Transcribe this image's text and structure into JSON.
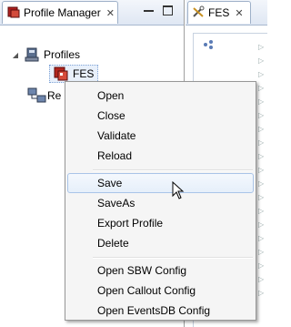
{
  "left_view": {
    "tab_title": "Profile Manager",
    "close_glyph": "✕",
    "tree": {
      "profiles_label": "Profiles",
      "fes_label": "FES",
      "second_root_label": "Re"
    }
  },
  "right_view": {
    "tab_title": "FES",
    "close_glyph": "✕"
  },
  "context_menu": {
    "items": [
      {
        "label": "Open"
      },
      {
        "label": "Close"
      },
      {
        "label": "Validate"
      },
      {
        "label": "Reload"
      },
      {
        "label": "Save"
      },
      {
        "label": "SaveAs"
      },
      {
        "label": "Export Profile"
      },
      {
        "label": "Delete"
      },
      {
        "label": "Open SBW Config"
      },
      {
        "label": "Open Callout Config"
      },
      {
        "label": "Open EventsDB Config"
      }
    ],
    "hovered_item": "Save"
  },
  "colors": {
    "menu_bg": "#f5f5f5",
    "hover_border": "#a9c4e8",
    "selection_fill": "#e8f0fb"
  }
}
